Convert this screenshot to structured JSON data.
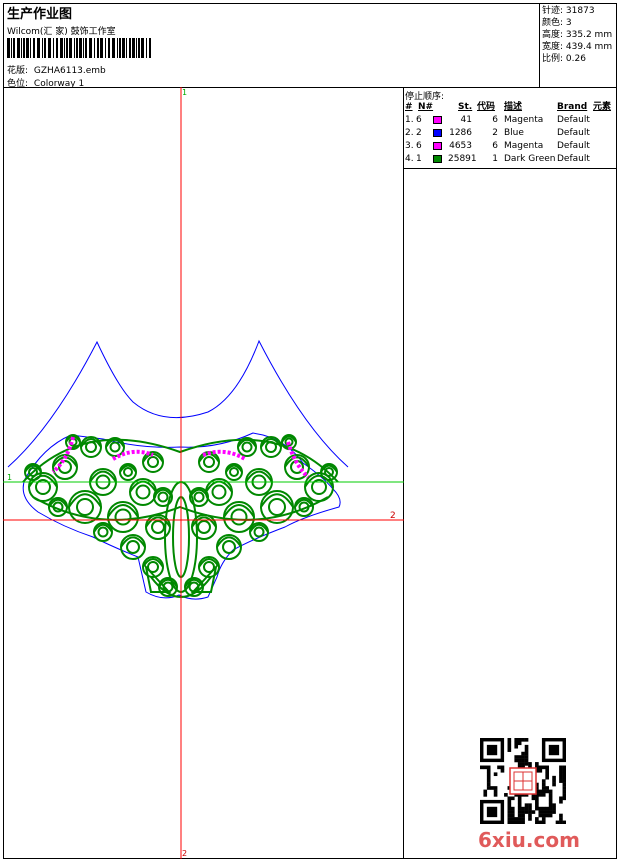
{
  "header": {
    "title": "生产作业图",
    "company": "Wilcom(汇 家) 鼓饰工作室",
    "design_label": "花版:",
    "design_file": "GZHA6113.emb",
    "colorway_label": "色位:",
    "colorway_value": "Colorway 1"
  },
  "stats": {
    "stitches_label": "针迹:",
    "stitches_value": "31873",
    "colors_label": "颜色:",
    "colors_value": "3",
    "height_label": "高度:",
    "height_value": "335.2 mm",
    "width_label": "宽度:",
    "width_value": "439.4 mm",
    "scale_label": "比例:",
    "scale_value": "0.26"
  },
  "stop_sequence": {
    "title": "停止顺序:",
    "headers": {
      "num": "#",
      "n": "N#",
      "st": "St.",
      "code": "代码",
      "desc": "描述",
      "brand": "Brand",
      "element": "元素"
    },
    "rows": [
      {
        "num": "1.",
        "n": "6",
        "color": "#ff00ff",
        "st": "41",
        "code": "6",
        "desc": "Magenta",
        "brand": "Default"
      },
      {
        "num": "2.",
        "n": "2",
        "color": "#0000ff",
        "st": "1286",
        "code": "2",
        "desc": "Blue",
        "brand": "Default"
      },
      {
        "num": "3.",
        "n": "6",
        "color": "#ff00ff",
        "st": "4653",
        "code": "6",
        "desc": "Magenta",
        "brand": "Default"
      },
      {
        "num": "4.",
        "n": "1",
        "color": "#008800",
        "st": "25891",
        "code": "1",
        "desc": "Dark Green",
        "brand": "Default"
      }
    ]
  },
  "axes": {
    "v_top": "1",
    "v_bottom": "2",
    "h_left": "1",
    "h_right": "2"
  },
  "watermark": {
    "site": "6xiu.com"
  },
  "colors": {
    "magenta": "#ff00ff",
    "blue": "#0000ff",
    "green": "#008800",
    "axis_red": "#ff0000",
    "axis_green": "#00cc00"
  }
}
